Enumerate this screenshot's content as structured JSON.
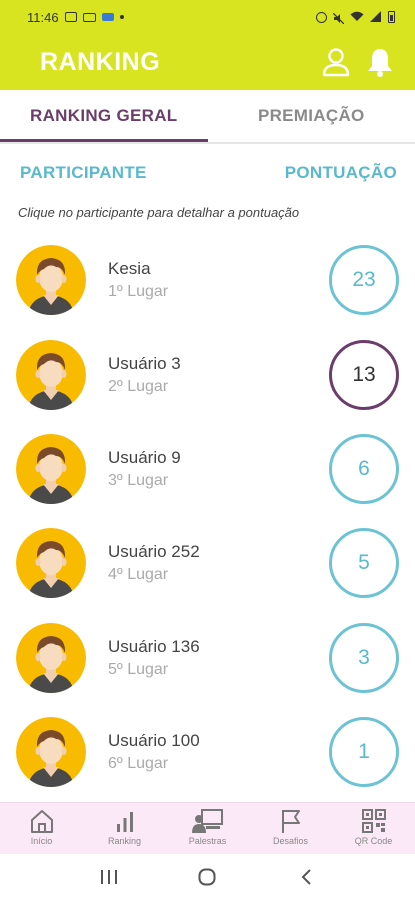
{
  "status_bar": {
    "time": "11:46",
    "icons_left": [
      "image-icon",
      "laptop-icon",
      "cast-icon",
      "dot-icon"
    ],
    "icons_right": [
      "alarm-icon",
      "mute-icon",
      "wifi-icon",
      "signal-icon",
      "battery-icon"
    ]
  },
  "app_bar": {
    "title": "RANKING",
    "actions": [
      "user-icon",
      "bell-icon"
    ]
  },
  "tabs": [
    {
      "label": "RANKING GERAL",
      "active": true
    },
    {
      "label": "PREMIAÇÃO",
      "active": false
    }
  ],
  "columns": {
    "participant": "PARTICIPANTE",
    "score": "PONTUAÇÃO"
  },
  "hint": "Clique no participante para detalhar a pontuação",
  "ranking": [
    {
      "name": "Kesia",
      "place": "1º Lugar",
      "score": "23",
      "highlight": false
    },
    {
      "name": "Usuário 3",
      "place": "2º Lugar",
      "score": "13",
      "highlight": true
    },
    {
      "name": "Usuário 9",
      "place": "3º Lugar",
      "score": "6",
      "highlight": false
    },
    {
      "name": "Usuário 252",
      "place": "4º Lugar",
      "score": "5",
      "highlight": false
    },
    {
      "name": "Usuário 136",
      "place": "5º Lugar",
      "score": "3",
      "highlight": false
    },
    {
      "name": "Usuário 100",
      "place": "6º Lugar",
      "score": "1",
      "highlight": false
    }
  ],
  "bottom_nav": [
    {
      "label": "Início",
      "icon": "home-icon"
    },
    {
      "label": "Ranking",
      "icon": "bar-chart-icon"
    },
    {
      "label": "Palestras",
      "icon": "presentation-icon"
    },
    {
      "label": "Desafios",
      "icon": "flag-icon"
    },
    {
      "label": "QR Code",
      "icon": "qr-code-icon"
    }
  ],
  "colors": {
    "accent": "#d8e41f",
    "purple": "#6b3d6b",
    "teal": "#5ab9cc",
    "avatar_bg": "#f9bb00",
    "nav_bg": "#fbe9f7"
  }
}
